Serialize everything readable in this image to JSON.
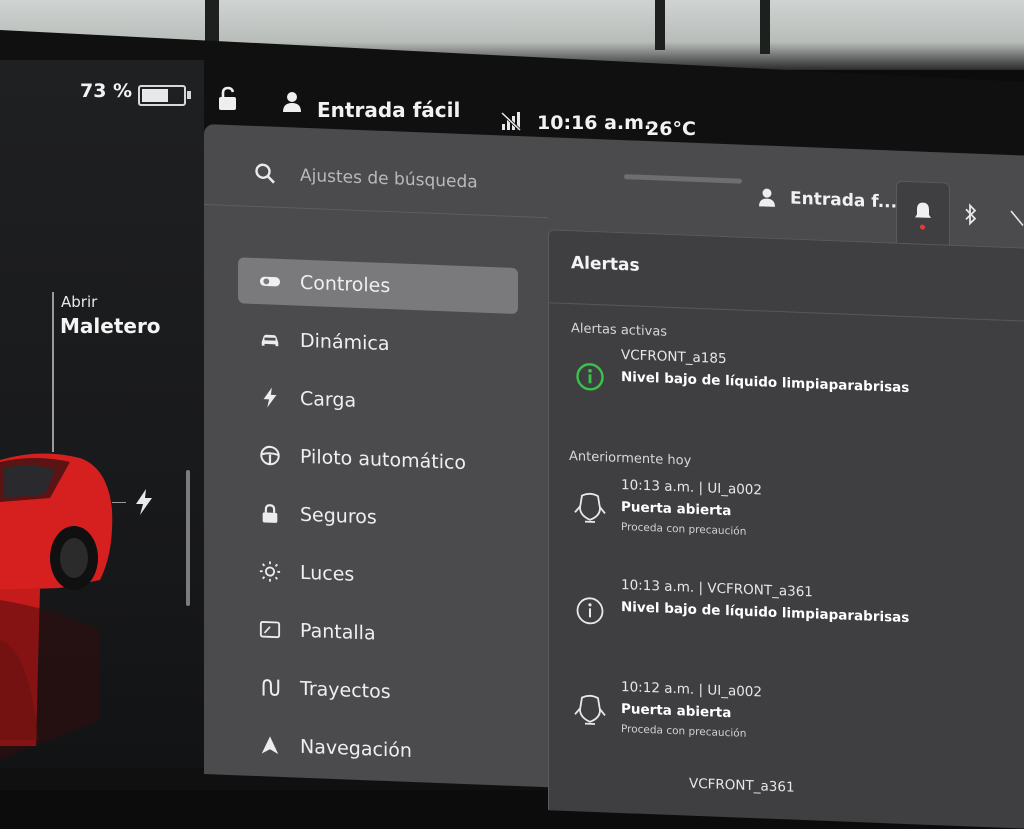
{
  "status_bar": {
    "battery_percent_label": "73 %",
    "battery_level": 0.73,
    "profile_name": "Entrada fácil",
    "time": "10:16 a.m.",
    "temperature": "26°C"
  },
  "car_panel": {
    "trunk_action": "Abrir",
    "trunk_label": "Maletero"
  },
  "search": {
    "placeholder": "Ajustes de búsqueda"
  },
  "header": {
    "profile_short": "Entrada f..."
  },
  "menu": {
    "items": [
      {
        "label": "Controles",
        "icon": "toggle-icon",
        "active": true
      },
      {
        "label": "Dinámica",
        "icon": "car-icon"
      },
      {
        "label": "Carga",
        "icon": "lightning-icon"
      },
      {
        "label": "Piloto automático",
        "icon": "steering-wheel-icon"
      },
      {
        "label": "Seguros",
        "icon": "lock-icon"
      },
      {
        "label": "Luces",
        "icon": "sun-icon"
      },
      {
        "label": "Pantalla",
        "icon": "display-icon"
      },
      {
        "label": "Trayectos",
        "icon": "route-icon"
      },
      {
        "label": "Navegación",
        "icon": "navigation-icon"
      }
    ]
  },
  "alerts": {
    "title": "Alertas",
    "active_label": "Alertas activas",
    "active": [
      {
        "code": "VCFRONT_a185",
        "title": "Nivel bajo de líquido limpiaparabrisas"
      }
    ],
    "earlier_label": "Anteriormente hoy",
    "earlier": [
      {
        "code": "10:13 a.m. | UI_a002",
        "title": "Puerta abierta",
        "sub": "Proceda con precaución",
        "icon": "door-open-icon"
      },
      {
        "code": "10:13 a.m. | VCFRONT_a361",
        "title": "Nivel bajo de líquido limpiaparabrisas",
        "sub": "",
        "icon": "info-icon"
      },
      {
        "code": "10:12 a.m. | UI_a002",
        "title": "Puerta abierta",
        "sub": "Proceda con precaución",
        "icon": "door-open-icon"
      },
      {
        "code": "VCFRONT_a361",
        "title": "",
        "sub": "",
        "icon": "info-icon"
      }
    ]
  },
  "colors": {
    "active_alert_icon": "#35c64a",
    "car_red": "#d6201f",
    "notification_dot": "#e23a3a"
  }
}
